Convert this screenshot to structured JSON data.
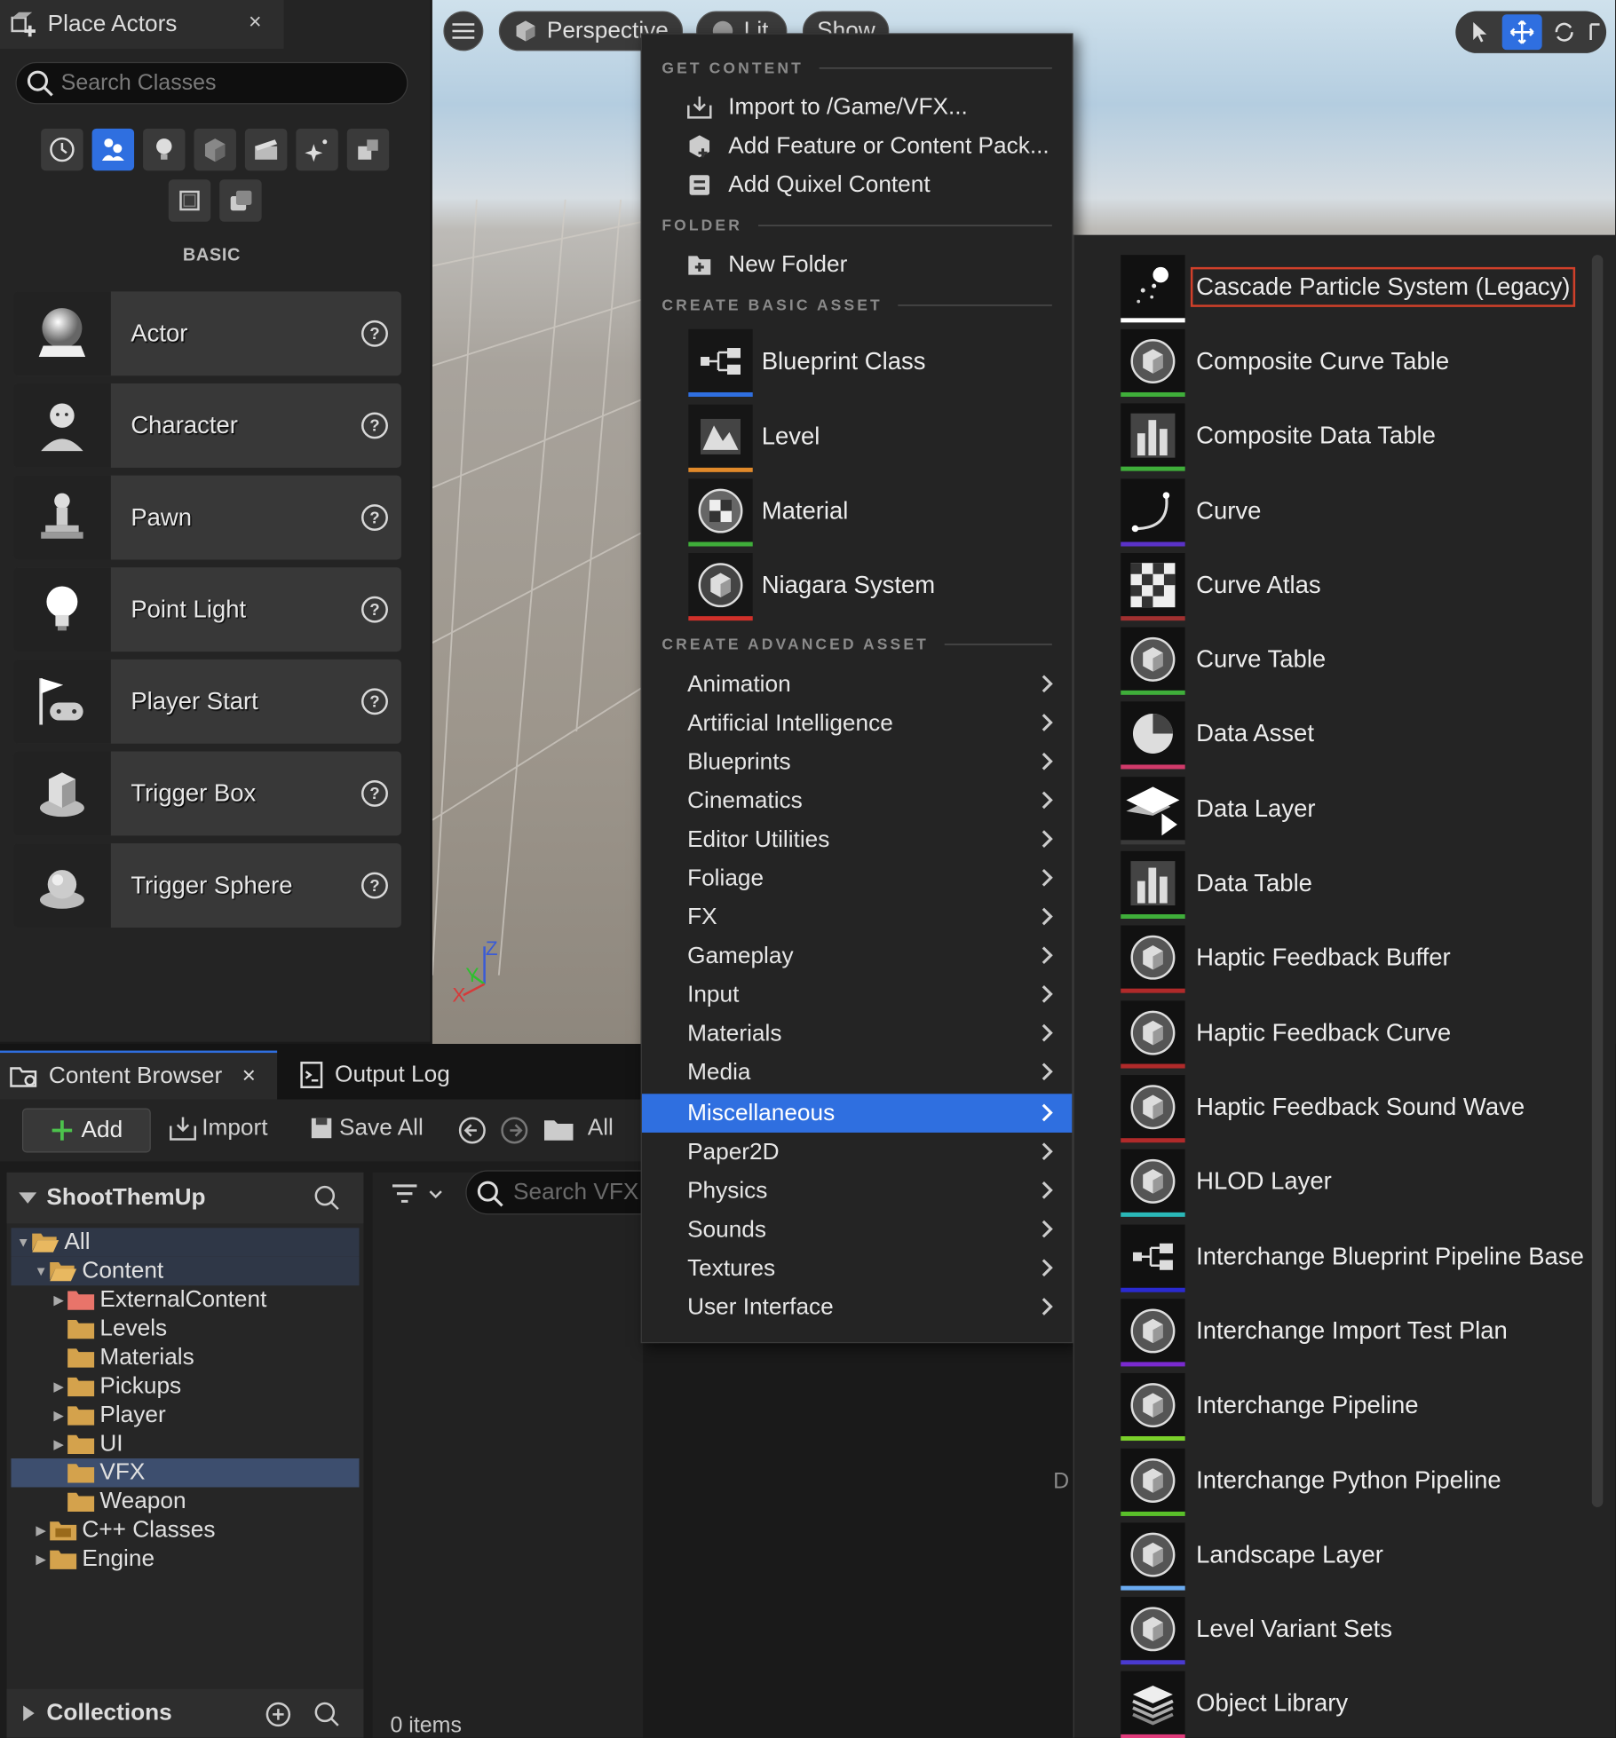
{
  "place_actors": {
    "tab_title": "Place Actors",
    "close_label": "×",
    "search_placeholder": "Search Classes",
    "category_label": "BASIC",
    "category_icons": [
      "recent-icon",
      "basic-icon",
      "lights-icon",
      "shapes-icon",
      "cinematic-icon",
      "visual-effects-icon",
      "geometry-icon",
      "volumes-icon",
      "all-classes-icon"
    ],
    "items": [
      {
        "label": "Actor",
        "icon": "actor-sphere-icon"
      },
      {
        "label": "Character",
        "icon": "character-icon"
      },
      {
        "label": "Pawn",
        "icon": "pawn-icon"
      },
      {
        "label": "Point Light",
        "icon": "point-light-icon"
      },
      {
        "label": "Player Start",
        "icon": "player-start-icon"
      },
      {
        "label": "Trigger Box",
        "icon": "trigger-box-icon"
      },
      {
        "label": "Trigger Sphere",
        "icon": "trigger-sphere-icon"
      }
    ],
    "help_glyph": "?"
  },
  "viewport": {
    "view_mode": "Perspective",
    "lit_mode": "Lit",
    "show_label": "Show",
    "axis_labels": {
      "z": "Z",
      "y": "Y",
      "x": "X"
    }
  },
  "content_browser": {
    "tab_label": "Content Browser",
    "close_label": "×",
    "output_log_label": "Output Log",
    "add_label": "Add",
    "import_label": "Import",
    "save_all_label": "Save All",
    "path_label": "All",
    "project_name": "ShootThemUp",
    "search_placeholder": "Search VFX",
    "items_count": "0 items",
    "collections_label": "Collections",
    "tree": [
      {
        "label": "All",
        "level": 0,
        "expanded": true
      },
      {
        "label": "Content",
        "level": 1,
        "expanded": true
      },
      {
        "label": "ExternalContent",
        "level": 2,
        "expanded": false
      },
      {
        "label": "Levels",
        "level": 2
      },
      {
        "label": "Materials",
        "level": 2
      },
      {
        "label": "Pickups",
        "level": 2,
        "expanded": false
      },
      {
        "label": "Player",
        "level": 2,
        "expanded": false
      },
      {
        "label": "UI",
        "level": 2,
        "expanded": false
      },
      {
        "label": "VFX",
        "level": 2,
        "selected": true
      },
      {
        "label": "Weapon",
        "level": 2
      },
      {
        "label": "C++ Classes",
        "level": 1,
        "expanded": false
      },
      {
        "label": "Engine",
        "level": 1,
        "expanded": false
      }
    ]
  },
  "add_menu": {
    "get_content_header": "GET CONTENT",
    "import_label": "Import to /Game/VFX...",
    "feature_pack_label": "Add Feature or Content Pack...",
    "quixel_label": "Add Quixel Content",
    "folder_header": "FOLDER",
    "new_folder_label": "New Folder",
    "basic_asset_header": "CREATE BASIC ASSET",
    "basic_assets": [
      {
        "label": "Blueprint Class",
        "color": "#2f6fe0"
      },
      {
        "label": "Level",
        "color": "#e0892a"
      },
      {
        "label": "Material",
        "color": "#3fae3a"
      },
      {
        "label": "Niagara System",
        "color": "#d0302a"
      }
    ],
    "advanced_asset_header": "CREATE ADVANCED ASSET",
    "categories": [
      "Animation",
      "Artificial Intelligence",
      "Blueprints",
      "Cinematics",
      "Editor Utilities",
      "Foliage",
      "FX",
      "Gameplay",
      "Input",
      "Materials",
      "Media",
      "Miscellaneous",
      "Paper2D",
      "Physics",
      "Sounds",
      "Textures",
      "User Interface"
    ],
    "active_category": "Miscellaneous"
  },
  "misc_menu": {
    "items": [
      {
        "label": "Cascade Particle System (Legacy)",
        "color": "#ffffff"
      },
      {
        "label": "Composite Curve Table",
        "color": "#3fae3a"
      },
      {
        "label": "Composite Data Table",
        "color": "#3fae3a"
      },
      {
        "label": "Curve",
        "color": "#5a32c8"
      },
      {
        "label": "Curve Atlas",
        "color": "#a03030"
      },
      {
        "label": "Curve Table",
        "color": "#3fae3a"
      },
      {
        "label": "Data Asset",
        "color": "#d03a6a"
      },
      {
        "label": "Data Layer",
        "color": "#3a3a3a"
      },
      {
        "label": "Data Table",
        "color": "#3fae3a"
      },
      {
        "label": "Haptic Feedback Buffer",
        "color": "#b02a2a"
      },
      {
        "label": "Haptic Feedback Curve",
        "color": "#b02a2a"
      },
      {
        "label": "Haptic Feedback Sound Wave",
        "color": "#b02a2a"
      },
      {
        "label": "HLOD Layer",
        "color": "#2ab8b8"
      },
      {
        "label": "Interchange Blueprint Pipeline Base",
        "color": "#2a2ad0"
      },
      {
        "label": "Interchange Import Test Plan",
        "color": "#7a2ad0"
      },
      {
        "label": "Interchange Pipeline",
        "color": "#7ad02a"
      },
      {
        "label": "Interchange Python Pipeline",
        "color": "#5ac02a"
      },
      {
        "label": "Landscape Layer",
        "color": "#6aaaf0"
      },
      {
        "label": "Level Variant Sets",
        "color": "#4a3ad0"
      },
      {
        "label": "Object Library",
        "color": "#e03a7a"
      }
    ]
  },
  "stray_text": "D"
}
